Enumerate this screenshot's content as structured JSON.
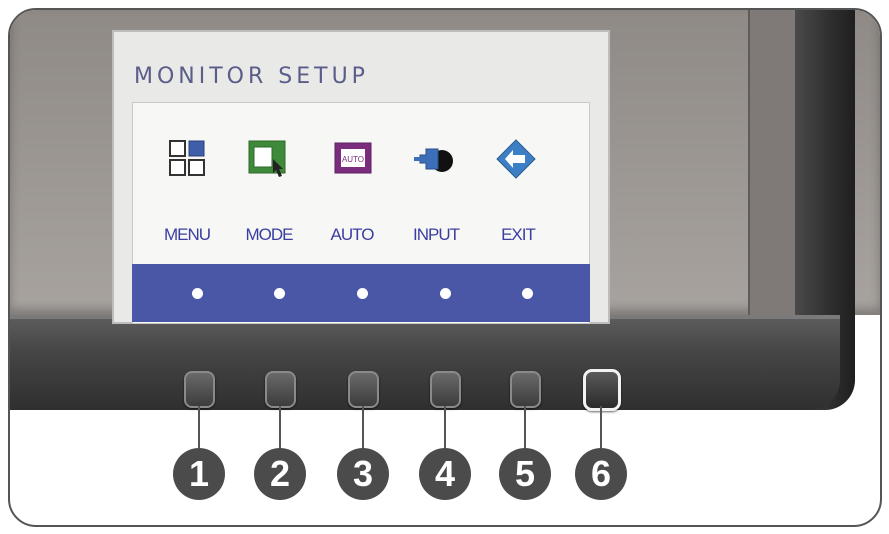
{
  "osd": {
    "title": "MONITOR SETUP",
    "items": [
      {
        "label": "MENU",
        "icon": "menu-grid-icon"
      },
      {
        "label": "MODE",
        "icon": "mode-window-icon"
      },
      {
        "label": "AUTO",
        "icon": "auto-adjust-icon"
      },
      {
        "label": "INPUT",
        "icon": "input-plug-icon"
      },
      {
        "label": "EXIT",
        "icon": "exit-arrow-icon"
      }
    ],
    "bar_color": "#4a57a6"
  },
  "buttons": [
    {
      "number": "1"
    },
    {
      "number": "2"
    },
    {
      "number": "3"
    },
    {
      "number": "4"
    },
    {
      "number": "5"
    },
    {
      "number": "6",
      "icon": "power-button"
    }
  ]
}
